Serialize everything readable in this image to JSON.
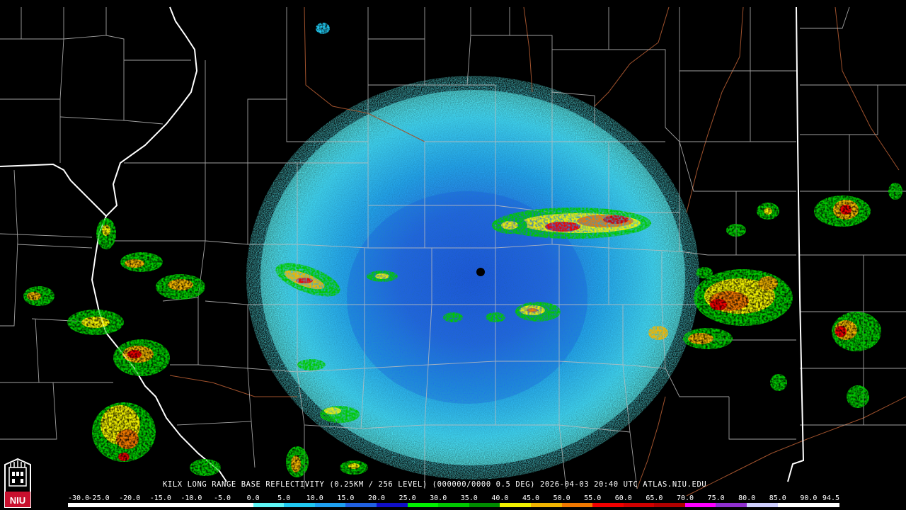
{
  "product": {
    "caption": "KILX LONG RANGE BASE REFLECTIVITY (0.25KM / 256 LEVEL) (000000/0000 0.5 DEG) 2026-04-03 20:40 UTC  ATLAS.NIU.EDU",
    "logo_text": "NIU"
  },
  "colors": {
    "background": "#000000",
    "county_lines": "#bdbdbd",
    "state_lines": "#ffffff",
    "rivers": "#a0522d",
    "radar_site": "#000000"
  },
  "scale": {
    "labels": [
      "-30.0",
      "-25.0",
      "-20.0",
      "-15.0",
      "-10.0",
      "-5.0",
      "0.0",
      "5.0",
      "10.0",
      "15.0",
      "20.0",
      "25.0",
      "30.0",
      "35.0",
      "40.0",
      "45.0",
      "50.0",
      "55.0",
      "60.0",
      "65.0",
      "70.0",
      "75.0",
      "80.0",
      "85.0",
      "90.0",
      "94.5"
    ],
    "segment_colors": [
      "#ffffff",
      "#ffffff",
      "#ffffff",
      "#ffffff",
      "#ffffff",
      "#ffffff",
      "#5ef5f5",
      "#20c8f0",
      "#1ea0f0",
      "#2060e0",
      "#1010c8",
      "#00f000",
      "#00c800",
      "#008c00",
      "#f0f000",
      "#f0b400",
      "#f07800",
      "#f00000",
      "#d00000",
      "#b00000",
      "#ff00ff",
      "#9030d0",
      "#d0d0ff",
      "#ffffff",
      "#ffffff"
    ]
  }
}
